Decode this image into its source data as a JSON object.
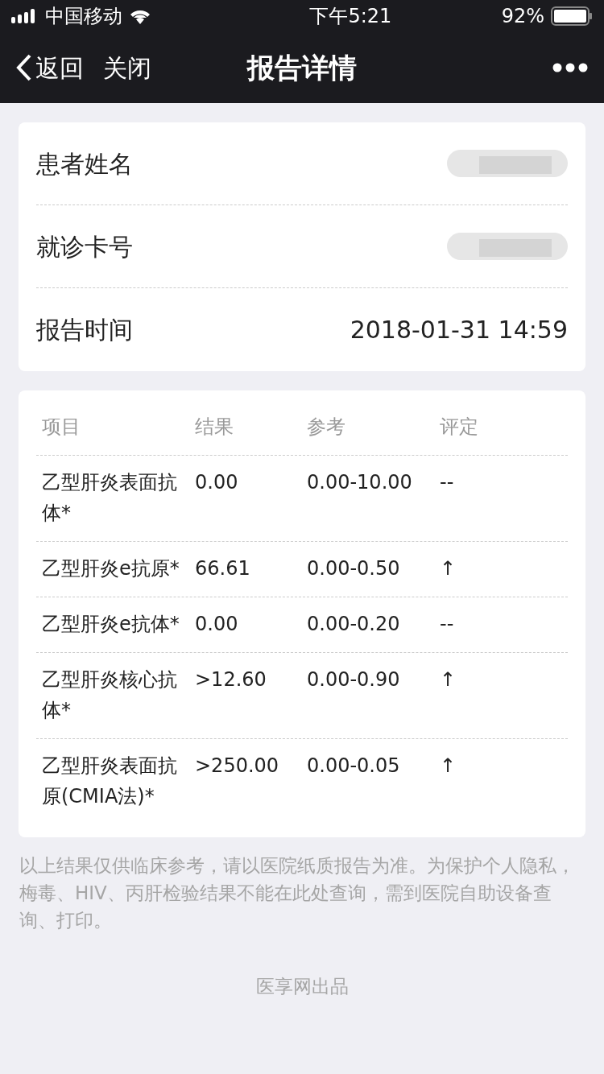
{
  "status_bar": {
    "carrier": "中国移动",
    "time": "下午5:21",
    "battery": "92%"
  },
  "nav": {
    "back": "返回",
    "close": "关闭",
    "title": "报告详情"
  },
  "info_rows": [
    {
      "label": "患者姓名",
      "redacted": true
    },
    {
      "label": "就诊卡号",
      "redacted": true
    },
    {
      "label": "报告时间",
      "value": "2018-01-31 14:59"
    }
  ],
  "table": {
    "columns": [
      "项目",
      "结果",
      "参考",
      "评定"
    ],
    "rows": [
      [
        "乙型肝炎表面抗体*",
        "0.00",
        "0.00-10.00",
        "--"
      ],
      [
        "乙型肝炎e抗原*",
        "66.61",
        "0.00-0.50",
        "↑"
      ],
      [
        "乙型肝炎e抗体*",
        "0.00",
        "0.00-0.20",
        "--"
      ],
      [
        "乙型肝炎核心抗体*",
        ">12.60",
        "0.00-0.90",
        "↑"
      ],
      [
        "乙型肝炎表面抗原(CMIA法)*",
        ">250.00",
        "0.00-0.05",
        "↑"
      ]
    ]
  },
  "note": "以上结果仅供临床参考，请以医院纸质报告为准。为保护个人隐私，梅毒、HIV、丙肝检验结果不能在此处查询，需到医院自助设备查询、打印。",
  "footer": "医享网出品"
}
